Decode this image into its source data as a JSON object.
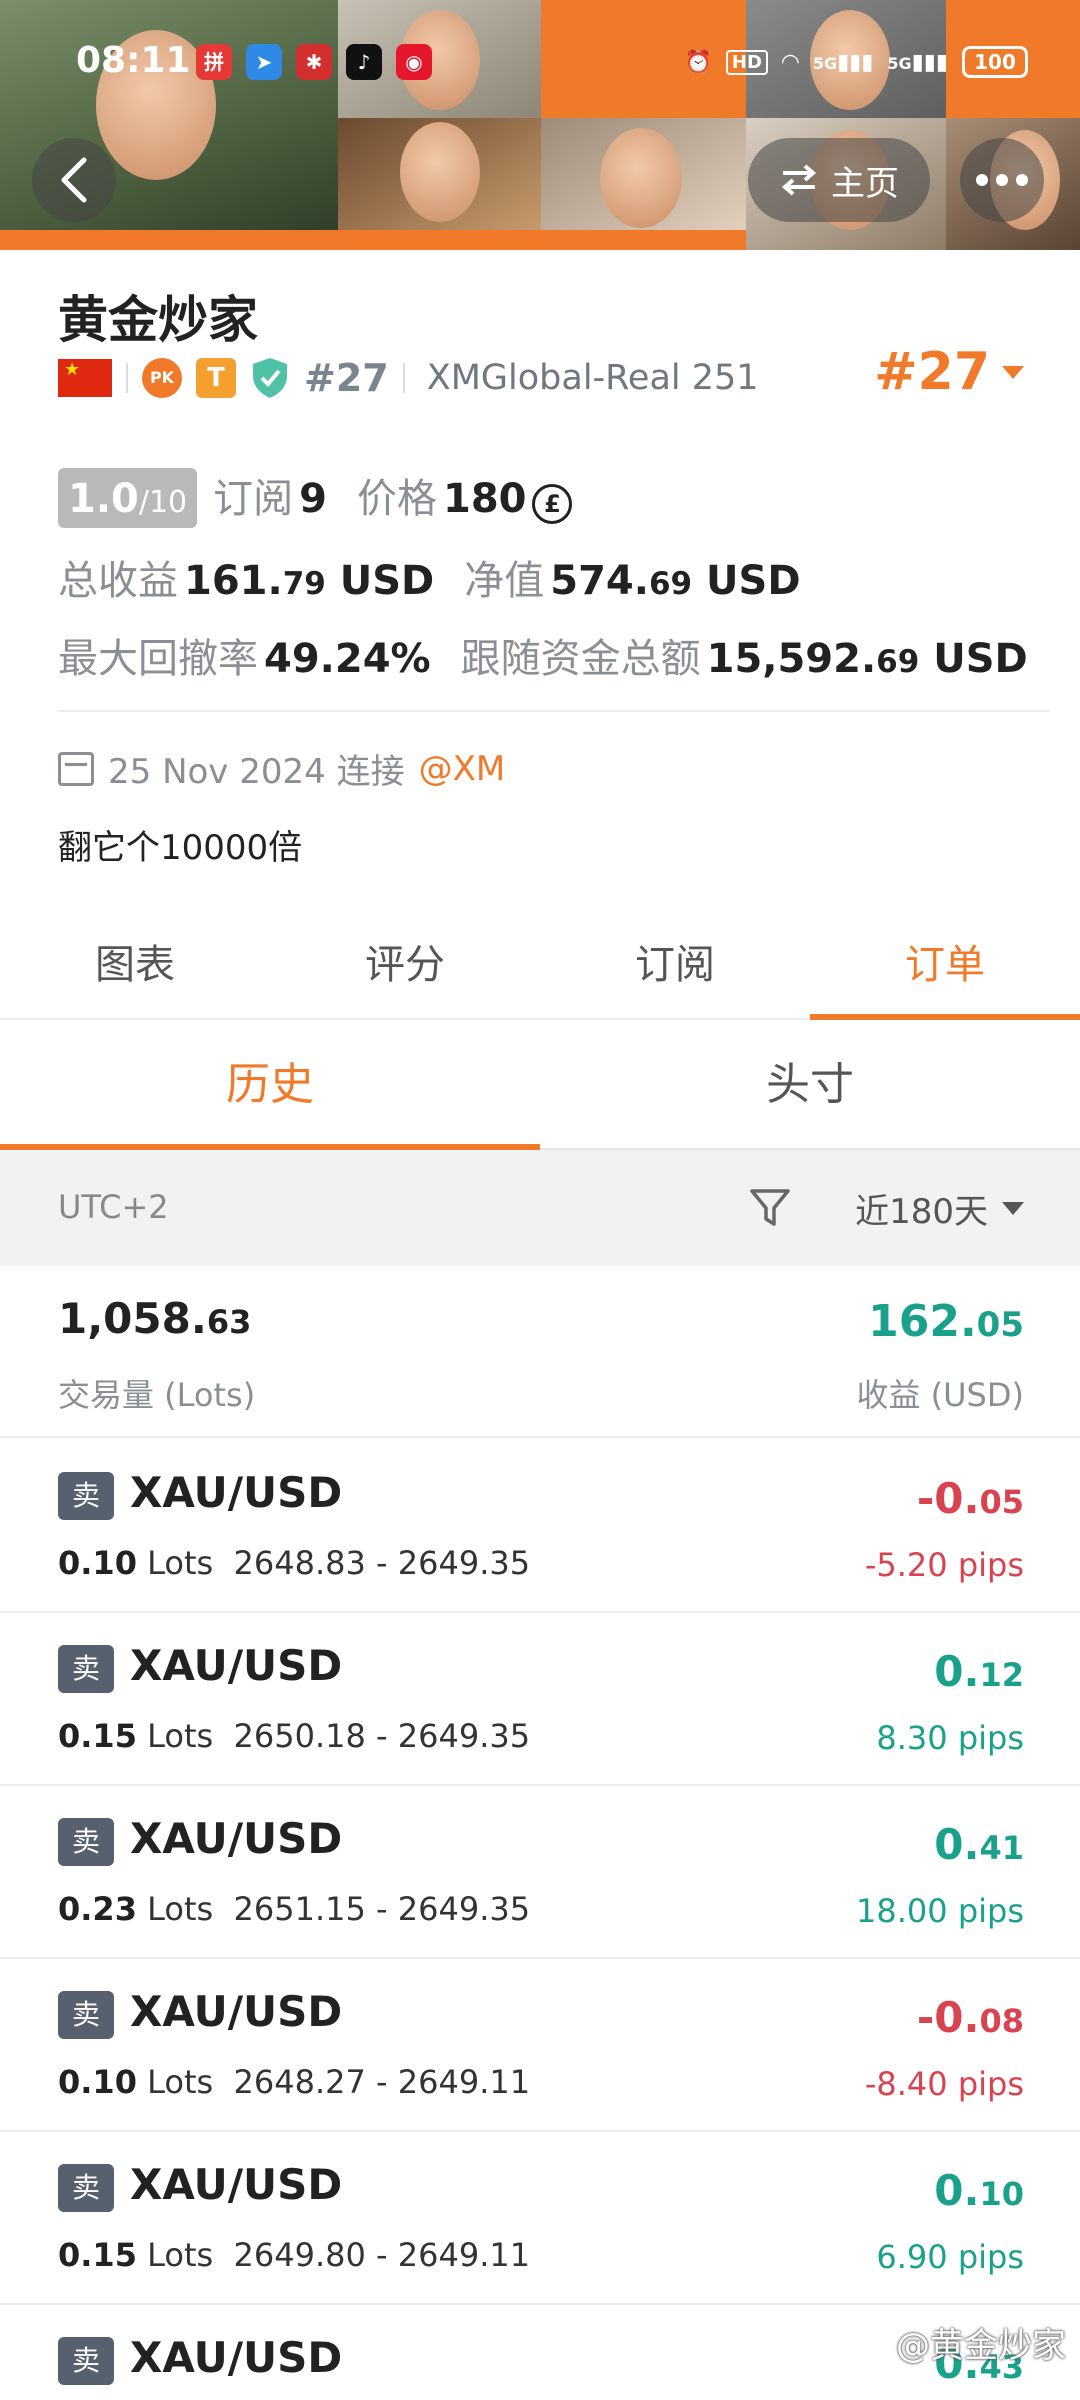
{
  "status_bar": {
    "time": "08:11",
    "signal_a": "5G",
    "signal_b": "5G",
    "hd_label": "HD",
    "battery": "100"
  },
  "nav": {
    "home_label": "主页"
  },
  "profile": {
    "name": "黄金炒家",
    "flag": "China",
    "pk_badge": "PK",
    "t_badge": "T",
    "rank_small": "#27",
    "broker": "XMGlobal-Real 251",
    "rank_big": "#27"
  },
  "stats": {
    "rating_int": "1.0",
    "rating_max": "/10",
    "subscribe_label": "订阅",
    "subscribe_count": "9",
    "price_label": "价格",
    "price_value": "180",
    "coin_symbol": "£",
    "total_profit_label": "总收益",
    "total_profit_int": "161.",
    "total_profit_dec": "79",
    "total_profit_unit": " USD",
    "equity_label": "净值",
    "equity_int": "574.",
    "equity_dec": "69",
    "equity_unit": " USD",
    "drawdown_label": "最大回撤率",
    "drawdown_value": "49.24%",
    "follow_label": "跟随资金总额",
    "follow_int": "15,592.",
    "follow_dec": "69",
    "follow_unit": " USD"
  },
  "joined": {
    "date": "25 Nov 2024 连接",
    "broker": "@XM"
  },
  "bio": "翻它个10000倍",
  "tabs": [
    {
      "label": "图表",
      "active": false
    },
    {
      "label": "评分",
      "active": false
    },
    {
      "label": "订阅",
      "active": false
    },
    {
      "label": "订单",
      "active": true
    }
  ],
  "subtabs": [
    {
      "label": "历史",
      "active": true
    },
    {
      "label": "头寸",
      "active": false
    }
  ],
  "filter": {
    "timezone": "UTC+2",
    "range": "近180天"
  },
  "summary": {
    "volume_int": "1,058.",
    "volume_dec": "63",
    "volume_label": "交易量 (Lots)",
    "profit_int": "162.",
    "profit_dec": "05",
    "profit_label": "收益 (USD)"
  },
  "orders": [
    {
      "side": "卖",
      "symbol": "XAU/USD",
      "lots": "0.10",
      "lots_unit": " Lots",
      "prices": "2648.83 - 2649.35",
      "profit_int": "-0.",
      "profit_dec": "05",
      "pips": "-5.20 pips",
      "positive": false
    },
    {
      "side": "卖",
      "symbol": "XAU/USD",
      "lots": "0.15",
      "lots_unit": " Lots",
      "prices": "2650.18 - 2649.35",
      "profit_int": "0.",
      "profit_dec": "12",
      "pips": "8.30 pips",
      "positive": true
    },
    {
      "side": "卖",
      "symbol": "XAU/USD",
      "lots": "0.23",
      "lots_unit": " Lots",
      "prices": "2651.15 - 2649.35",
      "profit_int": "0.",
      "profit_dec": "41",
      "pips": "18.00 pips",
      "positive": true
    },
    {
      "side": "卖",
      "symbol": "XAU/USD",
      "lots": "0.10",
      "lots_unit": " Lots",
      "prices": "2648.27 - 2649.11",
      "profit_int": "-0.",
      "profit_dec": "08",
      "pips": "-8.40 pips",
      "positive": false
    },
    {
      "side": "卖",
      "symbol": "XAU/USD",
      "lots": "0.15",
      "lots_unit": " Lots",
      "prices": "2649.80 - 2649.11",
      "profit_int": "0.",
      "profit_dec": "10",
      "pips": "6.90 pips",
      "positive": true
    },
    {
      "side": "卖",
      "symbol": "XAU/USD",
      "lots": "",
      "lots_unit": "",
      "prices": "",
      "profit_int": "0.",
      "profit_dec": "43",
      "pips": "",
      "positive": true
    }
  ],
  "watermark": "@黄金炒家",
  "colors": {
    "accent": "#f07a2a",
    "positive": "#1aa18b",
    "negative": "#d9434f"
  },
  "icons": [
    "back-arrow-icon",
    "swap-icon",
    "more-icon",
    "calendar-icon",
    "filter-icon",
    "dropdown-triangle-icon"
  ]
}
